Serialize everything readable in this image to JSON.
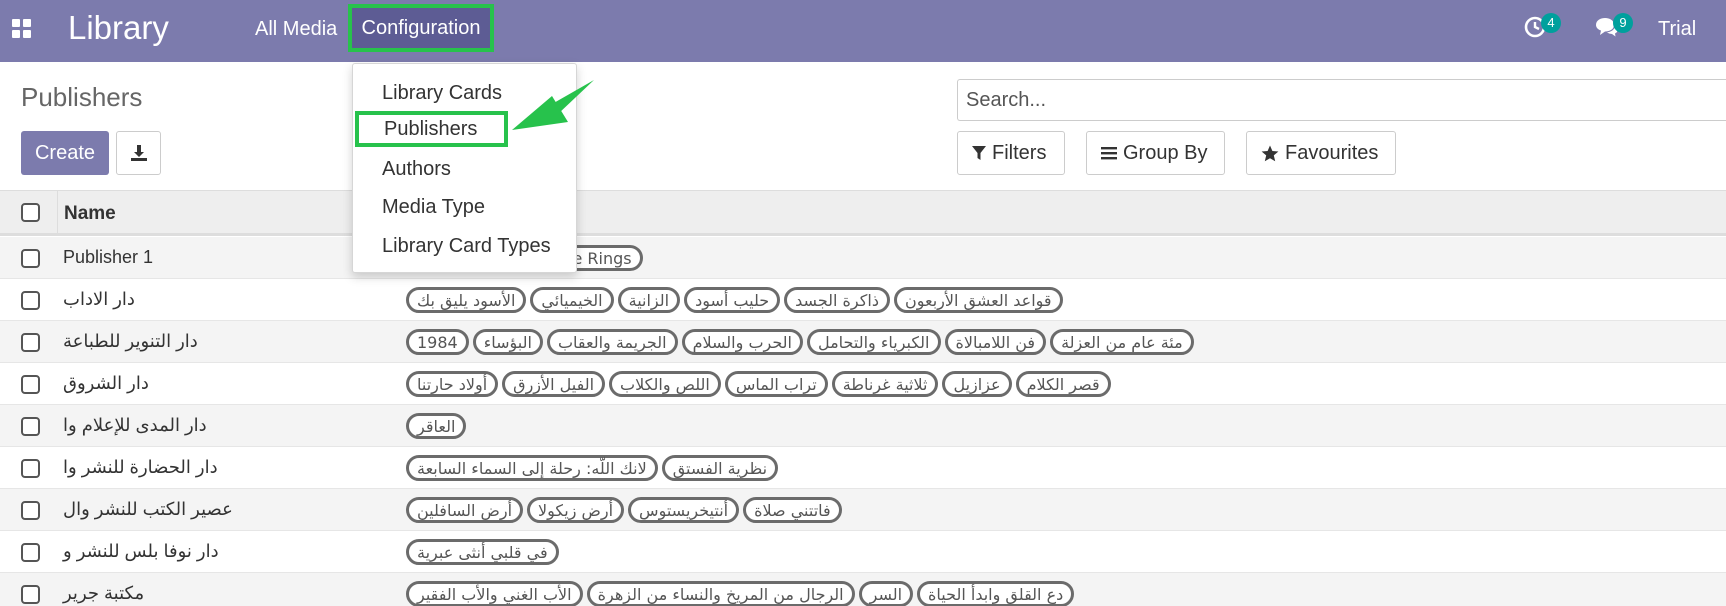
{
  "navbar": {
    "brand": "Library",
    "menu": [
      "All Media",
      "Configuration"
    ],
    "activity_count": "4",
    "message_count": "9",
    "user": "Trial",
    "bg_color": "#7c7bad",
    "highlight_color": "#27c24c"
  },
  "dropdown": {
    "items": [
      "Library Cards",
      "Publishers",
      "Authors",
      "Media Type",
      "Library Card Types"
    ]
  },
  "control_panel": {
    "title": "Publishers",
    "create_label": "Create",
    "search_placeholder": "Search...",
    "filters_label": "Filters",
    "group_by_label": "Group By",
    "favourites_label": "Favourites"
  },
  "table": {
    "columns": [
      "Name"
    ],
    "rows": [
      {
        "name": "Publisher 1",
        "tags": [
          "l of the Rings"
        ]
      },
      {
        "name": "دار الاداب",
        "tags": [
          "قواعد العشق الأربعون",
          "ذاكرة الجسد",
          "حليب أسود",
          "الزانية",
          "الخيميائي",
          "الأسود يليق بك"
        ]
      },
      {
        "name": "دار التنوير للطباعة",
        "tags": [
          "مئة عام من العزلة",
          "فن اللامبالاة",
          "الكبرياء والتحامل",
          "الحرب والسلام",
          "الجريمة والعقاب",
          "البؤساء",
          "1984"
        ]
      },
      {
        "name": "دار الشروق",
        "tags": [
          "قصر الكلام",
          "عزازيل",
          "ثلاثية غرناطة",
          "تراب الماس",
          "اللص والكلاب",
          "الفيل الأزرق",
          "أولاد حارتنا"
        ]
      },
      {
        "name": "دار المدى للإعلام وا",
        "tags": [
          "العاقر"
        ]
      },
      {
        "name": "دار الحضارة للنشر وا",
        "tags": [
          "نظرية الفستق",
          "لانك اللّه: رحلة إلى السماء السابعة"
        ]
      },
      {
        "name": "عصير الكتب للنشر وال",
        "tags": [
          "فاتتني صلاة",
          "أنتيخريستوس",
          "أرض زيكولا",
          "أرض السافلين"
        ]
      },
      {
        "name": "دار نوفا بلس للنشر و",
        "tags": [
          "في قلبي أنثى عبرية"
        ]
      },
      {
        "name": "مكتبة جرير",
        "tags": [
          "دع القلق وابدأ الحياة",
          "السر",
          "الرجال من المريخ والنساء من الزهرة",
          "الأب الغني والأب الفقير"
        ]
      }
    ]
  }
}
